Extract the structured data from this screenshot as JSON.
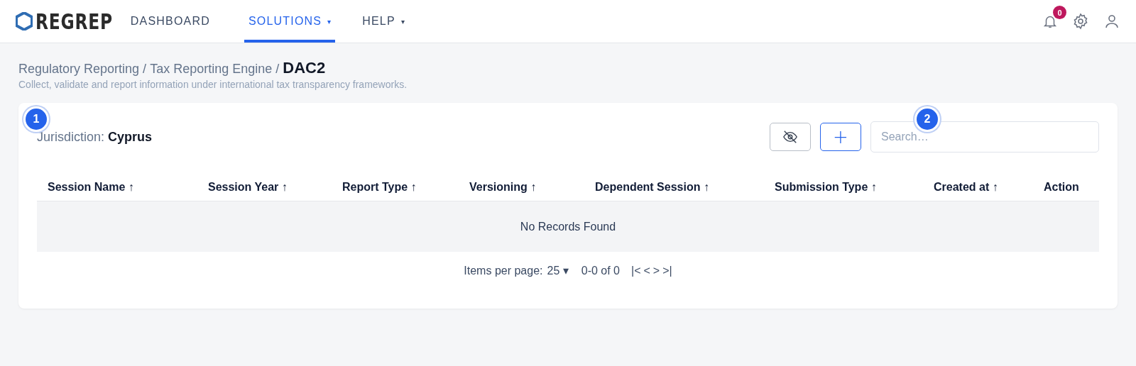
{
  "navbar": {
    "logo": "REGREP",
    "items": [
      {
        "label": "DASHBOARD",
        "selected": false
      },
      {
        "label": "SOLUTIONS",
        "selected": true,
        "caret": "▾"
      },
      {
        "label": "HELP",
        "selected": false,
        "caret": "▾"
      }
    ],
    "notification_count": "0"
  },
  "breadcrumb": {
    "items": [
      "Regulatory Reporting",
      "Tax Reporting Engine"
    ],
    "separator": "/",
    "current": "DAC2"
  },
  "subtitle": "Collect, validate and report information under international tax transparency frameworks.",
  "card": {
    "jurisdiction_label": "Jurisdiction:",
    "jurisdiction": "Cyprus",
    "add_button": "+",
    "jurisdiction_tour_marker": "1",
    "search": {
      "placeholder": "Search…",
      "tour_marker": "2"
    },
    "table": {
      "columns": [
        {
          "label": "Session Name",
          "sort": "↑"
        },
        {
          "label": "Session Year",
          "sort": "↑"
        },
        {
          "label": "Report Type",
          "sort": "↑"
        },
        {
          "label": "Versioning",
          "sort": "↑"
        },
        {
          "label": "Dependent Session",
          "sort": "↑"
        },
        {
          "label": "Submission Type",
          "sort": "↑"
        },
        {
          "label": "Created at",
          "sort": "↑"
        },
        {
          "label": "Action"
        }
      ],
      "empty_message": "No Records Found"
    },
    "pagination": {
      "items_per_page_label": "Items per page:",
      "items_per_page": "25 ▾",
      "range": "0-0 of 0",
      "buttons": [
        "|<",
        "<",
        ">",
        ">|"
      ]
    }
  }
}
